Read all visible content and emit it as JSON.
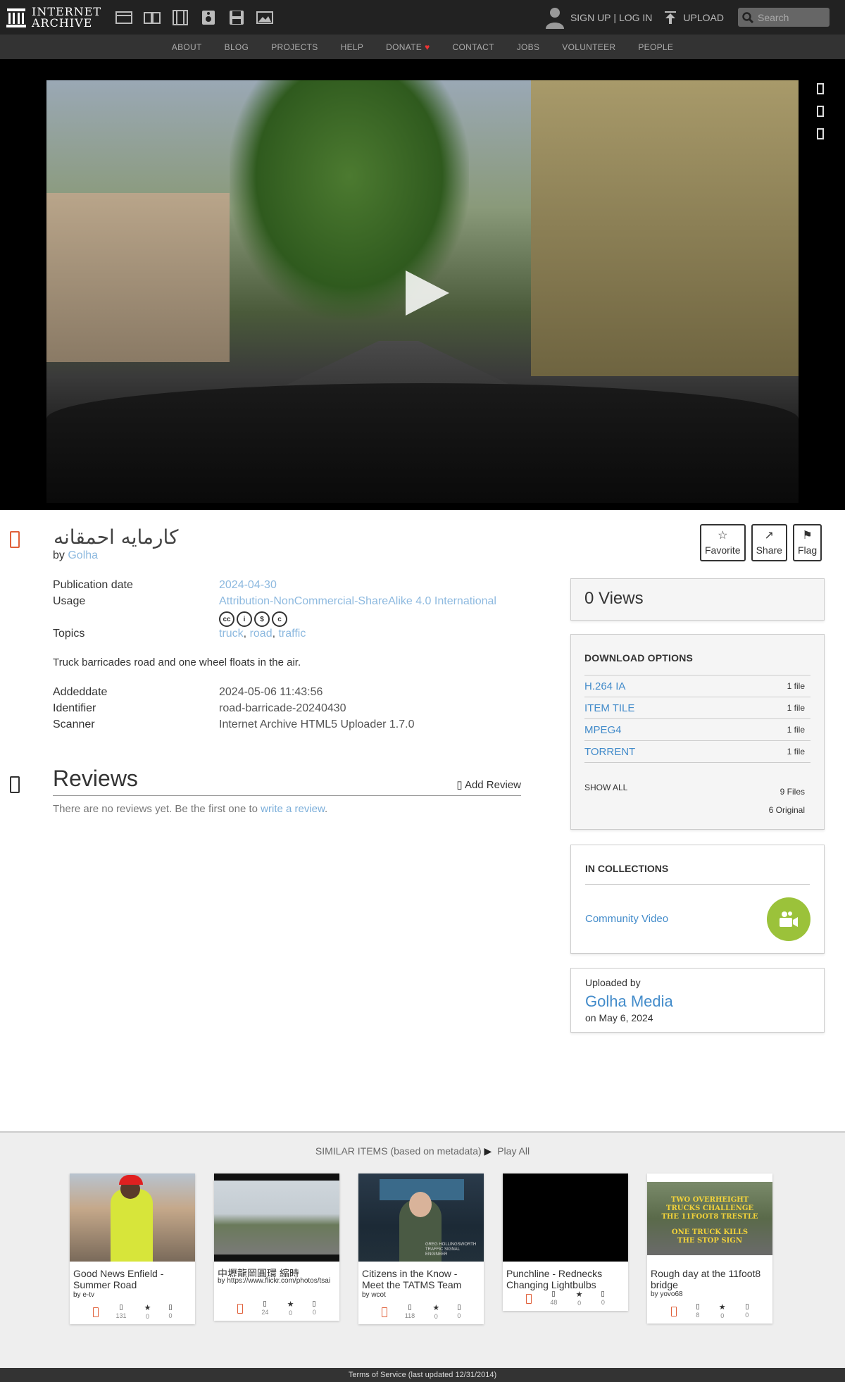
{
  "header": {
    "logo_line1": "INTERNET",
    "logo_line2": "ARCHIVE",
    "signup": "SIGN UP",
    "separator": "|",
    "login": "LOG IN",
    "upload": "UPLOAD",
    "search_placeholder": "Search",
    "media_icons": [
      "web-icon",
      "texts-icon",
      "video-icon",
      "audio-icon",
      "software-icon",
      "images-icon"
    ]
  },
  "subnav": [
    "ABOUT",
    "BLOG",
    "PROJECTS",
    "HELP",
    "DONATE",
    "CONTACT",
    "JOBS",
    "VOLUNTEER",
    "PEOPLE"
  ],
  "item": {
    "title": "کارمایه احمقانه",
    "by_label": "by",
    "creator": "Golha",
    "actions": [
      {
        "icon": "☆",
        "label": "Favorite"
      },
      {
        "icon": "↗",
        "label": "Share"
      },
      {
        "icon": "⚑",
        "label": "Flag"
      }
    ]
  },
  "metadata": {
    "pubdate_label": "Publication date",
    "pubdate": "2024-04-30",
    "usage_label": "Usage",
    "usage": "Attribution-NonCommercial-ShareAlike 4.0 International",
    "cc_icons": [
      "cc",
      "i",
      "$",
      "c"
    ],
    "topics_label": "Topics",
    "topics": [
      "truck",
      "road",
      "traffic"
    ],
    "topic_sep": ", ",
    "description": "Truck barricades road and one wheel floats in the air.",
    "addeddate_label": "Addeddate",
    "addeddate": "2024-05-06 11:43:56",
    "identifier_label": "Identifier",
    "identifier": "road-barricade-20240430",
    "scanner_label": "Scanner",
    "scanner": "Internet Archive HTML5 Uploader 1.7.0"
  },
  "reviews": {
    "heading": "Reviews",
    "add": "Add Review",
    "empty_text": "There are no reviews yet. Be the first one to ",
    "empty_link": "write a review",
    "empty_end": "."
  },
  "views": "0 Views",
  "downloads": {
    "heading": "DOWNLOAD OPTIONS",
    "rows": [
      {
        "format": "H.264 IA",
        "count": "1 file"
      },
      {
        "format": "ITEM TILE",
        "count": "1 file"
      },
      {
        "format": "MPEG4",
        "count": "1 file"
      },
      {
        "format": "TORRENT",
        "count": "1 file"
      }
    ],
    "show_all": "SHOW ALL",
    "files": "9 Files",
    "original": "6 Original"
  },
  "collections": {
    "heading": "IN COLLECTIONS",
    "name": "Community Video"
  },
  "uploader": {
    "label": "Uploaded by",
    "name": "Golha Media",
    "date": "on May 6, 2024"
  },
  "similar": {
    "heading": "SIMILAR ITEMS (based on metadata)",
    "play_all": "Play All",
    "cards": [
      {
        "title": "Good News Enfield - Summer Road",
        "by": "by e-tv",
        "views": "131",
        "favs": "0",
        "reviews": "0"
      },
      {
        "title": "中壢龍岡圓環 縮時",
        "by": "by https://www.flickr.com/photos/tsai",
        "views": "24",
        "favs": "0",
        "reviews": "0"
      },
      {
        "title": "Citizens in the Know - Meet the TATMS Team",
        "by": "by wcot",
        "views": "118",
        "favs": "0",
        "reviews": "0"
      },
      {
        "title": "Punchline - Rednecks Changing Lightbulbs",
        "by": "",
        "views": "48",
        "favs": "0",
        "reviews": "0"
      },
      {
        "title": "Rough day at the 11foot8 bridge",
        "by": "by yovo68",
        "views": "8",
        "favs": "0",
        "reviews": "0"
      }
    ]
  },
  "thumb_text": {
    "card3_caption": "GREG HOLLINGSWORTH TRAFFIC SIGNAL ENGINEER",
    "card5_line1": "TWO OVERHEIGHT",
    "card5_line2": "TRUCKS CHALLENGE",
    "card5_line3": "THE 11FOOT8 TRESTLE",
    "card5_line4": "ONE TRUCK KILLS",
    "card5_line5": "THE STOP SIGN"
  },
  "footer": "Terms of Service (last updated 12/31/2014)"
}
